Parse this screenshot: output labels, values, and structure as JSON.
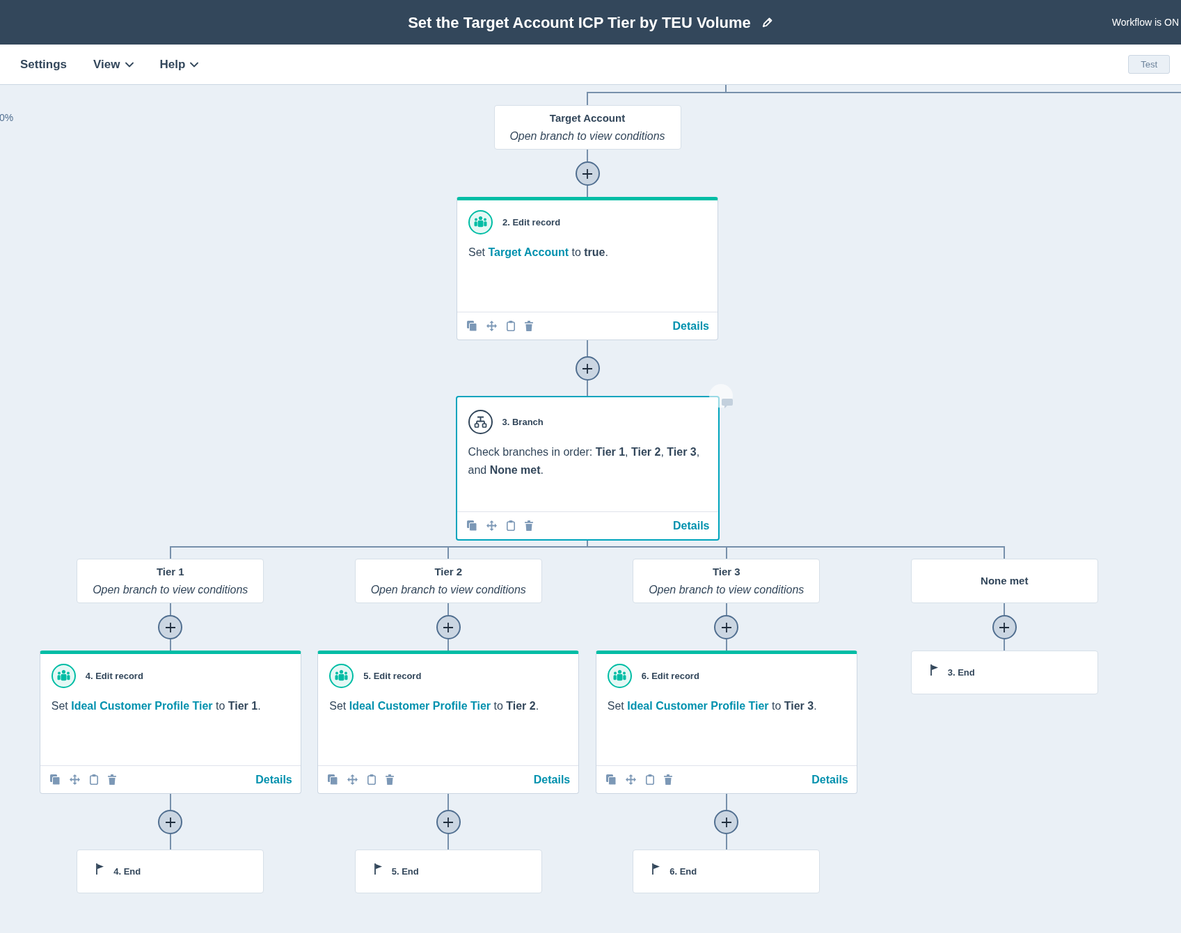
{
  "header": {
    "title": "Set the Target Account ICP Tier by TEU Volume",
    "status": "Workflow is ON"
  },
  "nav": {
    "items": [
      {
        "label": "Settings",
        "dropdown": false
      },
      {
        "label": "View",
        "dropdown": true
      },
      {
        "label": "Help",
        "dropdown": true
      }
    ],
    "test_button": "Test"
  },
  "canvas": {
    "zoom_label": "0%"
  },
  "workflow": {
    "nodes": [
      {
        "kind": "branch_label",
        "title": "Target Account",
        "subtitle": "Open branch to view conditions"
      },
      {
        "kind": "edit_record",
        "title": "2. Edit record",
        "selected": false,
        "description": [
          {
            "kind": "text",
            "text": "Set "
          },
          {
            "kind": "property",
            "text": "Target Account"
          },
          {
            "kind": "text",
            "text": " to "
          },
          {
            "kind": "value",
            "text": "true"
          },
          {
            "kind": "text",
            "text": "."
          }
        ],
        "link": "Details"
      },
      {
        "kind": "branch",
        "title": "3. Branch",
        "selected": true,
        "description": [
          {
            "kind": "text",
            "text": "Check branches in order: "
          },
          {
            "kind": "value",
            "text": "Tier 1"
          },
          {
            "kind": "text",
            "text": ", "
          },
          {
            "kind": "value",
            "text": "Tier 2"
          },
          {
            "kind": "text",
            "text": ", "
          },
          {
            "kind": "value",
            "text": "Tier 3"
          },
          {
            "kind": "text",
            "text": ", and "
          },
          {
            "kind": "value",
            "text": "None met"
          },
          {
            "kind": "text",
            "text": "."
          }
        ],
        "link": "Details",
        "branches": [
          {
            "title": "Tier 1",
            "subtitle": "Open branch to view conditions",
            "nodes": [
              {
                "kind": "edit_record",
                "title": "4. Edit record",
                "selected": false,
                "description": [
                  {
                    "kind": "text",
                    "text": "Set "
                  },
                  {
                    "kind": "property",
                    "text": "Ideal Customer Profile Tier"
                  },
                  {
                    "kind": "text",
                    "text": " to "
                  },
                  {
                    "kind": "value",
                    "text": "Tier 1"
                  },
                  {
                    "kind": "text",
                    "text": "."
                  }
                ],
                "link": "Details"
              },
              {
                "kind": "end",
                "title": "4. End"
              }
            ]
          },
          {
            "title": "Tier 2",
            "subtitle": "Open branch to view conditions",
            "nodes": [
              {
                "kind": "edit_record",
                "title": "5. Edit record",
                "selected": false,
                "description": [
                  {
                    "kind": "text",
                    "text": "Set "
                  },
                  {
                    "kind": "property",
                    "text": "Ideal Customer Profile Tier"
                  },
                  {
                    "kind": "text",
                    "text": " to "
                  },
                  {
                    "kind": "value",
                    "text": "Tier 2"
                  },
                  {
                    "kind": "text",
                    "text": "."
                  }
                ],
                "link": "Details"
              },
              {
                "kind": "end",
                "title": "5. End"
              }
            ]
          },
          {
            "title": "Tier 3",
            "subtitle": "Open branch to view conditions",
            "nodes": [
              {
                "kind": "edit_record",
                "title": "6. Edit record",
                "selected": false,
                "description": [
                  {
                    "kind": "text",
                    "text": "Set "
                  },
                  {
                    "kind": "property",
                    "text": "Ideal Customer Profile Tier"
                  },
                  {
                    "kind": "text",
                    "text": " to "
                  },
                  {
                    "kind": "value",
                    "text": "Tier 3"
                  },
                  {
                    "kind": "text",
                    "text": "."
                  }
                ],
                "link": "Details"
              },
              {
                "kind": "end",
                "title": "6. End"
              }
            ]
          },
          {
            "title": "None met",
            "nodes": [
              {
                "kind": "end",
                "title": "3. End"
              }
            ]
          }
        ]
      }
    ]
  }
}
